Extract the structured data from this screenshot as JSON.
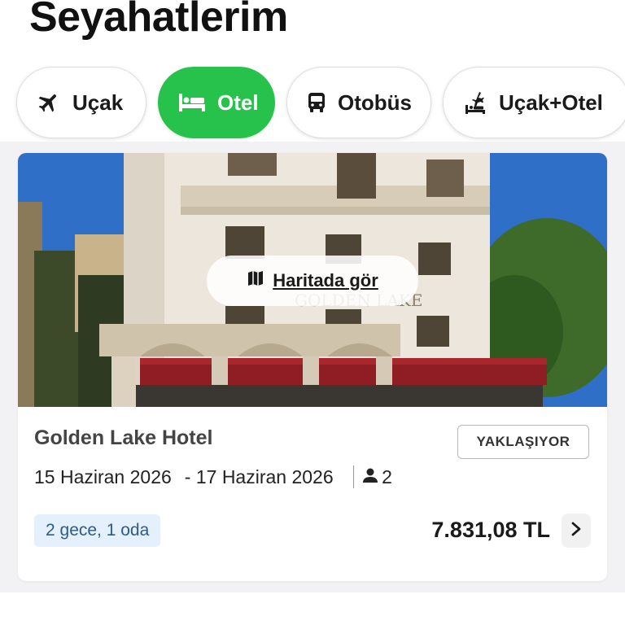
{
  "header": {
    "title": "Seyahatlerim"
  },
  "tabs": [
    {
      "label": "Uçak",
      "icon": "plane-icon",
      "active": false
    },
    {
      "label": "Otel",
      "icon": "bed-icon",
      "active": true
    },
    {
      "label": "Otobüs",
      "icon": "bus-icon",
      "active": false
    },
    {
      "label": "Uçak+Otel",
      "icon": "plane-hotel-icon",
      "active": false
    }
  ],
  "trip": {
    "map_label": "Haritada gör",
    "hotel_name": "Golden Lake Hotel",
    "status": "YAKLAŞIYOR",
    "check_in": "15 Haziran 2026",
    "check_out": "- 17 Haziran 2026",
    "guests": "2",
    "stay_summary": "2 gece, 1 oda",
    "price": "7.831,08 TL",
    "facade_sign": "GOLDEN LAKE"
  },
  "colors": {
    "active_tab": "#27c24c",
    "stay_tag_bg": "#e4f0fb",
    "stay_tag_text": "#2b5c8a"
  }
}
